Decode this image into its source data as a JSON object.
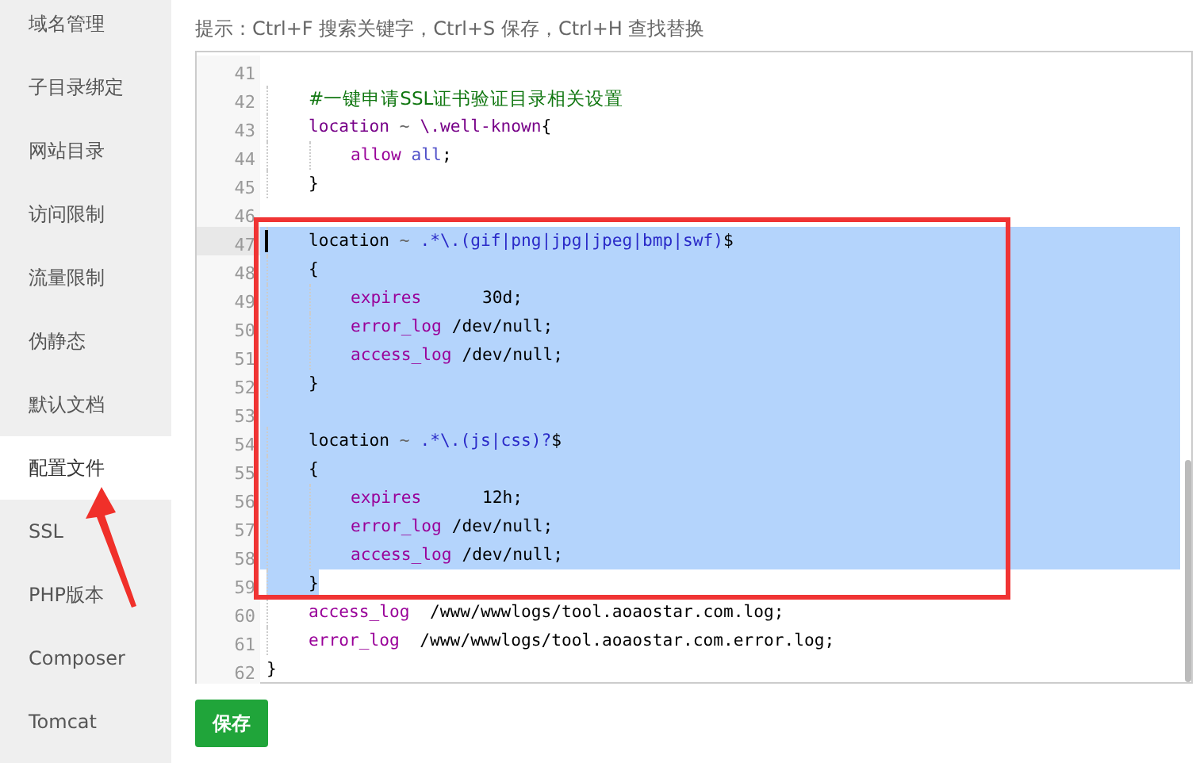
{
  "sidebar": {
    "items": [
      {
        "label": "域名管理",
        "selected": false
      },
      {
        "label": "子目录绑定",
        "selected": false
      },
      {
        "label": "网站目录",
        "selected": false
      },
      {
        "label": "访问限制",
        "selected": false
      },
      {
        "label": "流量限制",
        "selected": false
      },
      {
        "label": "伪静态",
        "selected": false
      },
      {
        "label": "默认文档",
        "selected": false
      },
      {
        "label": "配置文件",
        "selected": true
      },
      {
        "label": "SSL",
        "selected": false
      },
      {
        "label": "PHP版本",
        "selected": false
      },
      {
        "label": "Composer",
        "selected": false
      },
      {
        "label": "Tomcat",
        "selected": false
      }
    ]
  },
  "hint": "提示：Ctrl+F 搜索关键字，Ctrl+S 保存，Ctrl+H 查找替换",
  "editor": {
    "lines": [
      {
        "number": "41",
        "selected": false,
        "active": false
      },
      {
        "number": "42",
        "selected": false,
        "active": false,
        "tokens": [
          {
            "text": "    #一键申请SSL证书验证目录相关设置",
            "kind": "comment"
          }
        ]
      },
      {
        "number": "43",
        "selected": false,
        "active": false,
        "tokens": [
          {
            "text": "    location",
            "kind": "keyword"
          },
          {
            "text": " ~ ",
            "kind": "operator"
          },
          {
            "text": "\\.well-known",
            "kind": "keyword"
          },
          {
            "text": "{",
            "kind": "plain"
          }
        ]
      },
      {
        "number": "44",
        "selected": false,
        "active": false,
        "tokens": [
          {
            "text": "        allow",
            "kind": "directive"
          },
          {
            "text": " all",
            "kind": "atom"
          },
          {
            "text": ";",
            "kind": "plain"
          }
        ]
      },
      {
        "number": "45",
        "selected": false,
        "active": false,
        "tokens": [
          {
            "text": "    }",
            "kind": "plain"
          }
        ]
      },
      {
        "number": "46",
        "selected": false,
        "active": false
      },
      {
        "number": "47",
        "selected": true,
        "active": true,
        "tokens": [
          {
            "text": "    location",
            "kind": "plain"
          },
          {
            "text": " ~ ",
            "kind": "operator"
          },
          {
            "text": ".*\\.(gif|png|jpg|jpeg|bmp|swf)",
            "kind": "regex"
          },
          {
            "text": "$",
            "kind": "plain"
          }
        ]
      },
      {
        "number": "48",
        "selected": true,
        "active": false,
        "tokens": [
          {
            "text": "    {",
            "kind": "plain"
          }
        ]
      },
      {
        "number": "49",
        "selected": true,
        "active": false,
        "tokens": [
          {
            "text": "        expires",
            "kind": "directive"
          },
          {
            "text": "      30d;",
            "kind": "plain"
          }
        ]
      },
      {
        "number": "50",
        "selected": true,
        "active": false,
        "tokens": [
          {
            "text": "        error_log",
            "kind": "directive"
          },
          {
            "text": " /dev/null;",
            "kind": "plain"
          }
        ]
      },
      {
        "number": "51",
        "selected": true,
        "active": false,
        "tokens": [
          {
            "text": "        access_log",
            "kind": "directive"
          },
          {
            "text": " /dev/null;",
            "kind": "plain"
          }
        ]
      },
      {
        "number": "52",
        "selected": true,
        "active": false,
        "tokens": [
          {
            "text": "    }",
            "kind": "plain"
          }
        ]
      },
      {
        "number": "53",
        "selected": true,
        "active": false
      },
      {
        "number": "54",
        "selected": true,
        "active": false,
        "tokens": [
          {
            "text": "    location",
            "kind": "plain"
          },
          {
            "text": " ~ ",
            "kind": "operator"
          },
          {
            "text": ".*\\.(js|css)?",
            "kind": "regex"
          },
          {
            "text": "$",
            "kind": "plain"
          }
        ]
      },
      {
        "number": "55",
        "selected": true,
        "active": false,
        "tokens": [
          {
            "text": "    {",
            "kind": "plain"
          }
        ]
      },
      {
        "number": "56",
        "selected": true,
        "active": false,
        "tokens": [
          {
            "text": "        expires",
            "kind": "directive"
          },
          {
            "text": "      12h;",
            "kind": "plain"
          }
        ]
      },
      {
        "number": "57",
        "selected": true,
        "active": false,
        "tokens": [
          {
            "text": "        error_log",
            "kind": "directive"
          },
          {
            "text": " /dev/null;",
            "kind": "plain"
          }
        ]
      },
      {
        "number": "58",
        "selected": true,
        "active": false,
        "tokens": [
          {
            "text": "        access_log",
            "kind": "directive"
          },
          {
            "text": " /dev/null;",
            "kind": "plain"
          }
        ]
      },
      {
        "number": "59",
        "selected": true,
        "active": false,
        "tokens": [
          {
            "text": "    }",
            "kind": "plain"
          }
        ]
      },
      {
        "number": "60",
        "selected": false,
        "active": false,
        "tokens": [
          {
            "text": "    access_log",
            "kind": "directive"
          },
          {
            "text": "  /www/wwwlogs/tool.aoaostar.com.log;",
            "kind": "plain"
          }
        ]
      },
      {
        "number": "61",
        "selected": false,
        "active": false,
        "tokens": [
          {
            "text": "    error_log",
            "kind": "directive"
          },
          {
            "text": "  /www/wwwlogs/tool.aoaostar.com.error.log;",
            "kind": "plain"
          }
        ]
      },
      {
        "number": "62",
        "selected": false,
        "active": false,
        "tokens": [
          {
            "text": "}",
            "kind": "plain"
          }
        ]
      }
    ]
  },
  "save_button": "保存"
}
